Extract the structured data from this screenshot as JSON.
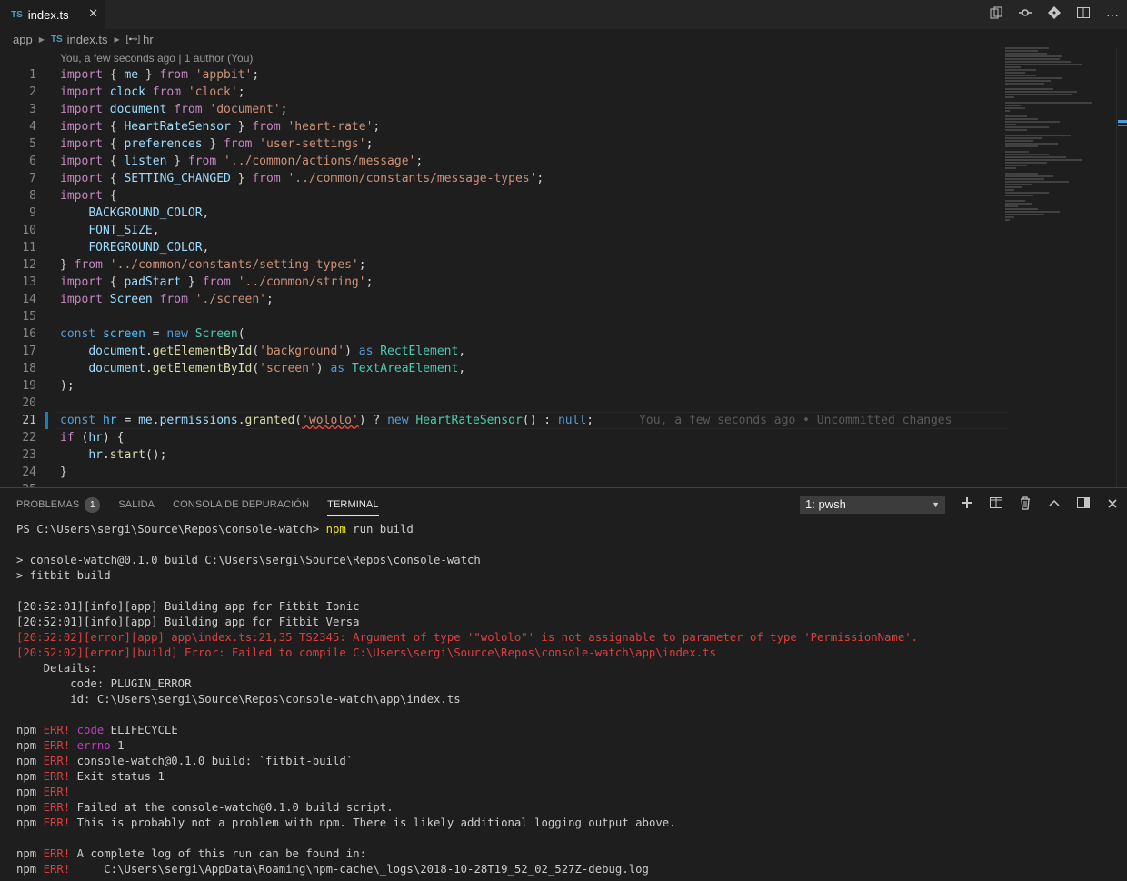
{
  "tab": {
    "icon": "TS",
    "title": "index.ts",
    "close": "✕"
  },
  "toolbar": {
    "icons": [
      "open-changes-icon",
      "git-history-icon",
      "git-compare-icon",
      "split-editor-icon",
      "more-actions-icon"
    ]
  },
  "breadcrumb": {
    "folder": "app",
    "file_icon": "TS",
    "file": "index.ts",
    "symbol": "hr"
  },
  "codelens": "You, a few seconds ago | 1 author (You)",
  "line_numbers": [
    "1",
    "2",
    "3",
    "4",
    "5",
    "6",
    "7",
    "8",
    "9",
    "10",
    "11",
    "12",
    "13",
    "14",
    "15",
    "16",
    "17",
    "18",
    "19",
    "20",
    "21",
    "22",
    "23",
    "24",
    "25"
  ],
  "active_line": "21",
  "code_tokens": {
    "l16_const": "const",
    "l16_screen": "screen",
    "l16_new": "new",
    "l16_Screen": "Screen",
    "l21_blame": "You, a few seconds ago • Uncommitted changes"
  },
  "panel": {
    "tabs": [
      "PROBLEMAS",
      "SALIDA",
      "CONSOLA DE DEPURACIÓN",
      "TERMINAL"
    ],
    "problems_count": "1",
    "active_tab": "TERMINAL",
    "terminal_select": "1: pwsh"
  },
  "terminal": {
    "prompt": "PS C:\\Users\\sergi\\Source\\Repos\\console-watch> ",
    "cmd_npm": "npm",
    "cmd_rest": " run build",
    "lines": [
      "",
      "> console-watch@0.1.0 build C:\\Users\\sergi\\Source\\Repos\\console-watch",
      "> fitbit-build",
      "",
      "[20:52:01][info][app] Building app for Fitbit Ionic",
      "[20:52:01][info][app] Building app for Fitbit Versa"
    ],
    "error_lines": [
      "[20:52:02][error][app] app\\index.ts:21,35 TS2345: Argument of type '\"wololo\"' is not assignable to parameter of type 'PermissionName'.",
      "[20:52:02][error][build] Error: Failed to compile C:\\Users\\sergi\\Source\\Repos\\console-watch\\app\\index.ts"
    ],
    "detail_lines": [
      "    Details:",
      "        code: PLUGIN_ERROR",
      "        id: C:\\Users\\sergi\\Source\\Repos\\console-watch\\app\\index.ts",
      ""
    ],
    "npm_err": [
      {
        "prefix": "npm ",
        "err": "ERR!",
        "key": " code",
        "rest": " ELIFECYCLE"
      },
      {
        "prefix": "npm ",
        "err": "ERR!",
        "key": " errno",
        "rest": " 1"
      },
      {
        "prefix": "npm ",
        "err": "ERR!",
        "key": "",
        "rest": " console-watch@0.1.0 build: `fitbit-build`"
      },
      {
        "prefix": "npm ",
        "err": "ERR!",
        "key": "",
        "rest": " Exit status 1"
      },
      {
        "prefix": "npm ",
        "err": "ERR!",
        "key": "",
        "rest": ""
      },
      {
        "prefix": "npm ",
        "err": "ERR!",
        "key": "",
        "rest": " Failed at the console-watch@0.1.0 build script."
      },
      {
        "prefix": "npm ",
        "err": "ERR!",
        "key": "",
        "rest": " This is probably not a problem with npm. There is likely additional logging output above."
      }
    ],
    "npm_err2": [
      {
        "prefix": "npm ",
        "err": "ERR!",
        "rest": " A complete log of this run can be found in:"
      },
      {
        "prefix": "npm ",
        "err": "ERR!",
        "rest": "     C:\\Users\\sergi\\AppData\\Roaming\\npm-cache\\_logs\\2018-10-28T19_52_02_527Z-debug.log"
      }
    ]
  },
  "colors": {
    "accent": "#1b81a8",
    "error": "#e03e3e",
    "keyword": "#569cd6",
    "string": "#ce9178"
  }
}
